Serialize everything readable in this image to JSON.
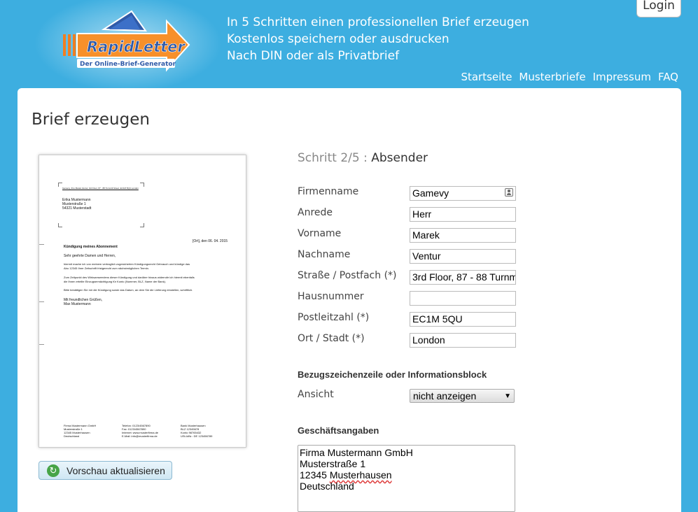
{
  "header": {
    "brand_name": "RapidLetter",
    "brand_subtitle": "Der Online-Brief-Generator",
    "taglines": [
      "In 5 Schritten einen professionellen Brief erzeugen",
      "Kostenlos speichern oder ausdrucken",
      "Nach DIN oder als Privatbrief"
    ],
    "login_label": "Login",
    "nav": [
      "Startseite",
      "Musterbriefe",
      "Impressum",
      "FAQ"
    ]
  },
  "page": {
    "title": "Brief erzeugen"
  },
  "preview": {
    "sender_line": "Gamevy, Ihre Marek Ventur, 3rd Floor, 87 - 88 Turnmill Street, EC1M 5QU London",
    "recipient": [
      "Erika Mustermann",
      "Musterstraße 1",
      "54321 Musterstadt"
    ],
    "date": "[Ort], den 06. 04. 2015",
    "subject": "Kündigung meines Abonnement",
    "salutation": "Sehr geehrte Damen und Herren,",
    "body_1": [
      "hiermit mache ich von meinem vertraglich zugesicherten Kündigungsrecht Gebrauch und kündige das",
      "Abo 12345 Ihrer Zeitschrift fristgerecht zum nächstmöglichen Termin."
    ],
    "body_2": [
      "Zum Zeitpunkt des Wirksamwerdens dieser Kündigung und darüber hinaus widerrufe ich hiermit ebenfalls",
      "die Ihnen erteilte Einzugsermächtigung für Konto (Nummer, BLZ, Name der Bank)."
    ],
    "body_3": "Bitte bestätigen Sie mir die Kündigung sowie das Datum, an dem Sie die Lieferung einstellen, schriftlich.",
    "closing": [
      "Mit freundlichen Grüßen,",
      "Max Mustermann"
    ],
    "footer_col1": [
      "Firma Mustermann GmbH",
      "Musterstraße 1",
      "12345 Musterhausen",
      "Deutschland"
    ],
    "footer_col2": [
      "Telefon: 0123/4567890",
      "Fax: 0123/4567890",
      "Internet: www.musterfirma.de",
      "E-Mail: info@musterfirma.de"
    ],
    "footer_col3": [
      "Bank Musterhausen",
      "BLZ 12345678",
      "Konto 98765432",
      "USt-IdNr.: DE 123456789"
    ],
    "refresh_label": "Vorschau aktualisieren"
  },
  "form": {
    "step_prefix": "Schritt 2/5 :",
    "step_name": "Absender",
    "fields": [
      {
        "label": "Firmenname",
        "value": "Gamevy"
      },
      {
        "label": "Anrede",
        "value": "Herr"
      },
      {
        "label": "Vorname",
        "value": "Marek"
      },
      {
        "label": "Nachname",
        "value": "Ventur"
      },
      {
        "label": "Straße / Postfach (*)",
        "value": "3rd Floor, 87 - 88 Turnm"
      },
      {
        "label": "Hausnummer",
        "value": ""
      },
      {
        "label": "Postleitzahl (*)",
        "value": "EC1M 5QU"
      },
      {
        "label": "Ort / Stadt (*)",
        "value": "London"
      }
    ],
    "info_block_heading": "Bezugszeichenzeile oder Informationsblock",
    "ansicht_label": "Ansicht",
    "ansicht_value": "nicht anzeigen",
    "business_heading": "Geschäftsangaben",
    "business_lines": [
      "Firma Mustermann GmbH",
      "Musterstraße 1",
      "12345",
      "Musterhausen",
      "Deutschland"
    ]
  }
}
